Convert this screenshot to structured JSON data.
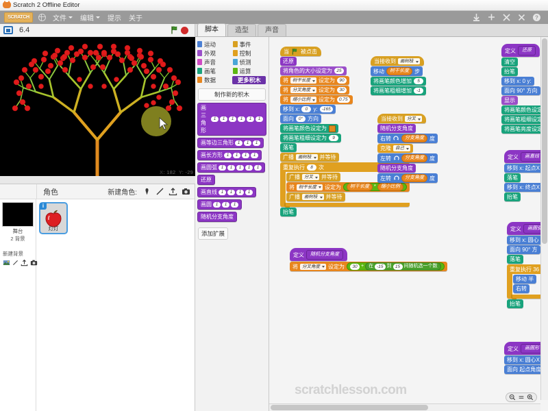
{
  "window": {
    "title": "Scratch 2 Offline Editor",
    "app_icon": "scratch-cat-icon"
  },
  "menubar": {
    "logo": "SCRATCH",
    "language_icon": "globe-icon",
    "items": [
      {
        "label": "文件",
        "has_caret": true
      },
      {
        "label": "编辑",
        "has_caret": true
      },
      {
        "label": "提示",
        "has_caret": false
      },
      {
        "label": "关于",
        "has_caret": false
      }
    ],
    "tools": [
      "stamp-icon",
      "grow-icon",
      "shrink-icon",
      "help-icon"
    ]
  },
  "stage": {
    "fullscreen_icon": "fullscreen-icon",
    "project_name": "6.4",
    "green_flag_icon": "green-flag-icon",
    "stop_icon": "stop-icon",
    "mouse_x_label": "X:",
    "mouse_x": "182",
    "mouse_y_label": "Y:",
    "mouse_y": "-29",
    "background_color": "#000000",
    "tree_trunk_color": "#e08a1e",
    "tree_branch_color": "#8cc63f",
    "berry_color": "#e01b1b",
    "cursor_glow_color": "#8a8a22"
  },
  "sprite_pane": {
    "title": "角色",
    "new_sprite_label": "新建角色:",
    "new_sprite_icons": [
      "paint-new-sprite-icon",
      "choose-sprite-icon",
      "upload-sprite-icon",
      "camera-sprite-icon"
    ],
    "stage_label": "舞台",
    "stage_backdrops": "2 背景",
    "new_backdrop_label": "新建背景",
    "new_backdrop_icons": [
      "choose-backdrop-icon",
      "paint-backdrop-icon",
      "upload-backdrop-icon",
      "camera-backdrop-icon"
    ],
    "sprites": [
      {
        "name": "灯灯",
        "info_badge": "i",
        "selected": true,
        "thumb": "apple-sprite"
      }
    ]
  },
  "tabs": [
    {
      "label": "脚本",
      "active": true
    },
    {
      "label": "造型",
      "active": false
    },
    {
      "label": "声音",
      "active": false
    }
  ],
  "palette": {
    "categories_left": [
      {
        "label": "运动",
        "color": "#4a7fd4"
      },
      {
        "label": "外观",
        "color": "#9a4ec9"
      },
      {
        "label": "声音",
        "color": "#cf4bc4"
      },
      {
        "label": "画笔",
        "color": "#19a37c"
      },
      {
        "label": "数据",
        "color": "#e8861d"
      }
    ],
    "categories_right": [
      {
        "label": "事件",
        "color": "#d8a022"
      },
      {
        "label": "控制",
        "color": "#e0a020"
      },
      {
        "label": "侦测",
        "color": "#4aa6d8"
      },
      {
        "label": "运算",
        "color": "#5cb712"
      }
    ],
    "more_blocks_label": "更多积木",
    "make_block_label": "制作新的积木",
    "add_extension_label": "添加扩展",
    "custom_blocks": [
      {
        "label": "画三角形",
        "args": 6
      },
      {
        "label": "画等边三角形",
        "args": 3
      },
      {
        "label": "画长方形",
        "args": 4
      },
      {
        "label": "画圆弧",
        "args": 5
      },
      {
        "label": "还原",
        "args": 0
      },
      {
        "label": "画直线",
        "args": 4
      },
      {
        "label": "画圆",
        "args": 3
      },
      {
        "label": "随机分支角度",
        "args": 0
      }
    ]
  },
  "scripts": {
    "watermark": "scratchlesson.com",
    "script1": {
      "hat": {
        "pre": "当",
        "icon": "green-flag-icon",
        "post": "被点击"
      },
      "rows": [
        {
          "type": "custom",
          "parts": [
            {
              "t": "text",
              "v": "还原"
            }
          ]
        },
        {
          "type": "looks",
          "parts": [
            {
              "t": "text",
              "v": "将角色的大小设定为"
            },
            {
              "t": "oval",
              "v": "25"
            }
          ]
        },
        {
          "type": "data",
          "parts": [
            {
              "t": "text",
              "v": "将"
            },
            {
              "t": "drop",
              "v": "树干长度"
            },
            {
              "t": "text",
              "v": "设定为"
            },
            {
              "t": "oval",
              "v": "90"
            }
          ]
        },
        {
          "type": "data",
          "parts": [
            {
              "t": "text",
              "v": "将"
            },
            {
              "t": "drop",
              "v": "分叉角度"
            },
            {
              "t": "text",
              "v": "设定为"
            },
            {
              "t": "oval",
              "v": "30"
            }
          ]
        },
        {
          "type": "data",
          "parts": [
            {
              "t": "text",
              "v": "将"
            },
            {
              "t": "drop",
              "v": "缩小比例"
            },
            {
              "t": "text",
              "v": "设定为"
            },
            {
              "t": "oval",
              "v": "0.75"
            }
          ]
        },
        {
          "type": "motion",
          "parts": [
            {
              "t": "text",
              "v": "移到 x:"
            },
            {
              "t": "oval",
              "v": "0"
            },
            {
              "t": "text",
              "v": "y:"
            },
            {
              "t": "oval",
              "v": "-165"
            }
          ]
        },
        {
          "type": "motion",
          "parts": [
            {
              "t": "text",
              "v": "面向"
            },
            {
              "t": "oval",
              "v": "0°"
            },
            {
              "t": "text",
              "v": "方向"
            }
          ]
        },
        {
          "type": "pen",
          "parts": [
            {
              "t": "text",
              "v": "将画笔颜色设定为"
            },
            {
              "t": "swatch",
              "v": "#e08a1e"
            }
          ]
        },
        {
          "type": "pen",
          "parts": [
            {
              "t": "text",
              "v": "将画笔粗细设定为"
            },
            {
              "t": "oval",
              "v": "9"
            }
          ]
        },
        {
          "type": "pen",
          "parts": [
            {
              "t": "text",
              "v": "落笔"
            }
          ]
        },
        {
          "type": "events",
          "parts": [
            {
              "t": "text",
              "v": "广播"
            },
            {
              "t": "drop",
              "v": "画树枝"
            },
            {
              "t": "text",
              "v": "并等待"
            }
          ]
        }
      ],
      "loop": {
        "head": [
          {
            "t": "text",
            "v": "重复执行"
          },
          {
            "t": "oval",
            "v": "8"
          },
          {
            "t": "text",
            "v": "次"
          }
        ],
        "body": [
          {
            "type": "events",
            "parts": [
              {
                "t": "text",
                "v": "广播"
              },
              {
                "t": "drop",
                "v": "分叉"
              },
              {
                "t": "text",
                "v": "并等待"
              }
            ]
          },
          {
            "type": "data",
            "parts": [
              {
                "t": "text",
                "v": "将"
              },
              {
                "t": "drop",
                "v": "树干长度"
              },
              {
                "t": "text",
                "v": "设定为"
              },
              {
                "t": "opblk",
                "v": "树干长度 * 缩小比例"
              }
            ]
          },
          {
            "type": "events",
            "parts": [
              {
                "t": "text",
                "v": "广播"
              },
              {
                "t": "drop",
                "v": "画树枝"
              },
              {
                "t": "text",
                "v": "并等待"
              }
            ]
          }
        ]
      },
      "tail": [
        {
          "type": "pen",
          "parts": [
            {
              "t": "text",
              "v": "抬笔"
            }
          ]
        }
      ]
    },
    "script2": {
      "hat": {
        "pre": "当接收到",
        "drop": "画树枝"
      },
      "rows": [
        {
          "type": "motion",
          "parts": [
            {
              "t": "text",
              "v": "移动"
            },
            {
              "t": "datavar",
              "v": "树干长度"
            },
            {
              "t": "text",
              "v": "步"
            }
          ]
        },
        {
          "type": "pen",
          "parts": [
            {
              "t": "text",
              "v": "将画笔颜色增加"
            },
            {
              "t": "oval",
              "v": "5"
            }
          ]
        },
        {
          "type": "pen",
          "parts": [
            {
              "t": "text",
              "v": "将画笔粗细增加"
            },
            {
              "t": "oval",
              "v": "-1"
            }
          ]
        }
      ]
    },
    "script3": {
      "hat": {
        "pre": "当接收到",
        "drop": "分叉"
      },
      "rows": [
        {
          "type": "custom",
          "parts": [
            {
              "t": "text",
              "v": "随机分支角度"
            }
          ]
        },
        {
          "type": "motion",
          "parts": [
            {
              "t": "text",
              "v": "右转"
            },
            {
              "t": "icon",
              "v": "turn-right-icon"
            },
            {
              "t": "datavar",
              "v": "分支角度"
            },
            {
              "t": "text",
              "v": "度"
            }
          ]
        },
        {
          "type": "control",
          "parts": [
            {
              "t": "text",
              "v": "克隆"
            },
            {
              "t": "drop",
              "v": "自己"
            }
          ]
        },
        {
          "type": "motion",
          "parts": [
            {
              "t": "text",
              "v": "左转"
            },
            {
              "t": "icon",
              "v": "turn-left-icon"
            },
            {
              "t": "datavar",
              "v": "分支角度"
            },
            {
              "t": "text",
              "v": "度"
            }
          ]
        },
        {
          "type": "custom",
          "parts": [
            {
              "t": "text",
              "v": "随机分支角度"
            }
          ]
        },
        {
          "type": "motion",
          "parts": [
            {
              "t": "text",
              "v": "左转"
            },
            {
              "t": "icon",
              "v": "turn-left-icon"
            },
            {
              "t": "datavar",
              "v": "分支角度"
            },
            {
              "t": "text",
              "v": "度"
            }
          ]
        }
      ]
    },
    "script4": {
      "define": {
        "pre": "定义",
        "name": "随机分支角度"
      },
      "rows": [
        {
          "type": "data",
          "parts": [
            {
              "t": "text",
              "v": "将"
            },
            {
              "t": "drop",
              "v": "分叉角度"
            },
            {
              "t": "text",
              "v": "设定为"
            },
            {
              "t": "oval",
              "v": "30"
            },
            {
              "t": "text",
              "v": "+"
            },
            {
              "t": "text",
              "v": "在"
            },
            {
              "t": "oval",
              "v": "-15"
            },
            {
              "t": "text",
              "v": "到"
            },
            {
              "t": "oval",
              "v": "15"
            },
            {
              "t": "text",
              "v": "间随机选一个数"
            }
          ]
        }
      ]
    },
    "clipped": [
      {
        "define": "还原",
        "rows": [
          "清空",
          "抬笔",
          "移到 x: 0 y:",
          "面向 90° 方向",
          "显示",
          "将画笔颜色设定",
          "将画笔粗细设定",
          "将画笔亮度设定"
        ]
      },
      {
        "define": "画直线  起",
        "rows": [
          "移到 x: 起点X",
          "落笔",
          "移到 x: 终点X",
          "抬笔"
        ]
      },
      {
        "define": "画圆弧",
        "rows": [
          "移到 x: 圆心",
          "面向 90° 方",
          "落笔",
          "重复执行 36",
          "移动  半",
          "右转",
          "抬笔"
        ]
      },
      {
        "define": "画圆形 圆心",
        "rows": [
          "移到 x: 圆心X  y:",
          "面向 起点角度  方向"
        ]
      }
    ]
  },
  "zoom_controls": {
    "out": "zoom-out-icon",
    "reset": "zoom-reset-icon",
    "in": "zoom-in-icon"
  }
}
